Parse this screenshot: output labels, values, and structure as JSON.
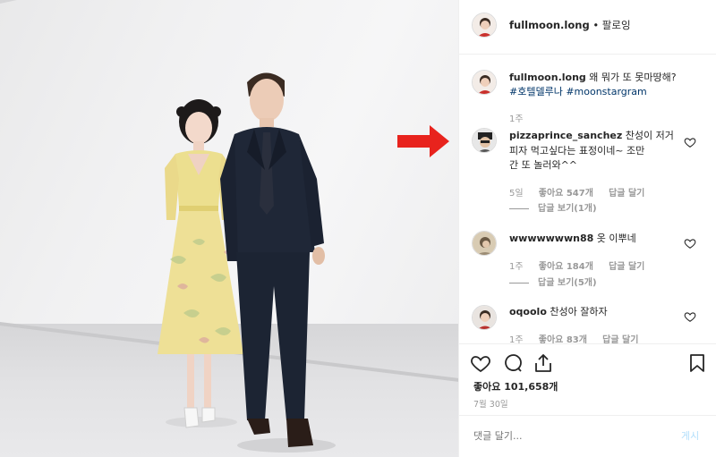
{
  "post": {
    "author": "fullmoon.long",
    "follow_status": "• 팔로잉",
    "caption_user": "fullmoon.long",
    "caption_text": "왜 뭐가 또 못마땅해?",
    "hashtags": "#호텔델루나 #moonstargram",
    "caption_time": "1주",
    "likes": "좋아요 101,658개",
    "date": "7월 30일",
    "comment_placeholder": "댓글 달기...",
    "post_button": "게시"
  },
  "comments": [
    {
      "user": "pizzaprince_sanchez",
      "line1": "찬성이 저거",
      "line2": "피자 먹고싶다는 표정이네~ 조만",
      "line3": "간 또 놀러와^^",
      "time": "5일",
      "likes": "좋아요 547개",
      "reply": "답글 달기",
      "view_replies": "답글 보기(1개)"
    },
    {
      "user": "wwwwwwwn88",
      "line1": "옷 이뿌네",
      "time": "1주",
      "likes": "좋아요 184개",
      "reply": "답글 달기",
      "view_replies": "답글 보기(5개)"
    },
    {
      "user": "oqoolo",
      "line1": "찬성아 잘하자",
      "time": "1주",
      "likes": "좋아요 83개",
      "reply": "답글 달기"
    }
  ],
  "colors": {
    "arrow": "#e8231d",
    "link": "#003569",
    "muted": "#999999"
  },
  "icons": [
    "heart-icon",
    "comment-icon",
    "share-icon",
    "bookmark-icon",
    "arrow-icon"
  ]
}
